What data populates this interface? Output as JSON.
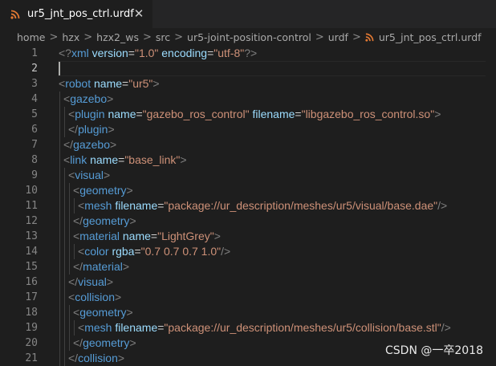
{
  "tab": {
    "label": "ur5_jnt_pos_ctrl.urdf",
    "close": "✕",
    "icon": "rss-icon"
  },
  "breadcrumb": {
    "parts": [
      "home",
      "hzx",
      "hzx2_ws",
      "src",
      "ur5-joint-position-control",
      "urdf"
    ],
    "separator": ">",
    "file": "ur5_jnt_pos_ctrl.urdf"
  },
  "editor": {
    "active_line": 2,
    "lines": [
      {
        "n": "1",
        "indent": 0,
        "tokens": [
          [
            "punct",
            "<?"
          ],
          [
            "tag",
            "xml"
          ],
          [
            "text",
            " "
          ],
          [
            "attr",
            "version"
          ],
          [
            "text",
            "="
          ],
          [
            "str",
            "\"1.0\""
          ],
          [
            "text",
            " "
          ],
          [
            "attr",
            "encoding"
          ],
          [
            "text",
            "="
          ],
          [
            "str",
            "\"utf-8\""
          ],
          [
            "punct",
            "?>"
          ]
        ]
      },
      {
        "n": "2",
        "indent": 0,
        "tokens": []
      },
      {
        "n": "3",
        "indent": 0,
        "tokens": [
          [
            "punct",
            "<"
          ],
          [
            "tag",
            "robot"
          ],
          [
            "text",
            " "
          ],
          [
            "attr",
            "name"
          ],
          [
            "text",
            "="
          ],
          [
            "str",
            "\"ur5\""
          ],
          [
            "punct",
            ">"
          ]
        ]
      },
      {
        "n": "4",
        "indent": 1,
        "tokens": [
          [
            "punct",
            "<"
          ],
          [
            "tag",
            "gazebo"
          ],
          [
            "punct",
            ">"
          ]
        ]
      },
      {
        "n": "5",
        "indent": 2,
        "tokens": [
          [
            "punct",
            "<"
          ],
          [
            "tag",
            "plugin"
          ],
          [
            "text",
            " "
          ],
          [
            "attr",
            "name"
          ],
          [
            "text",
            "="
          ],
          [
            "str",
            "\"gazebo_ros_control\""
          ],
          [
            "text",
            " "
          ],
          [
            "attr",
            "filename"
          ],
          [
            "text",
            "="
          ],
          [
            "str",
            "\"libgazebo_ros_control.so\""
          ],
          [
            "punct",
            ">"
          ]
        ]
      },
      {
        "n": "6",
        "indent": 2,
        "tokens": [
          [
            "punct",
            "</"
          ],
          [
            "tag",
            "plugin"
          ],
          [
            "punct",
            ">"
          ]
        ]
      },
      {
        "n": "7",
        "indent": 1,
        "tokens": [
          [
            "punct",
            "</"
          ],
          [
            "tag",
            "gazebo"
          ],
          [
            "punct",
            ">"
          ]
        ]
      },
      {
        "n": "8",
        "indent": 1,
        "tokens": [
          [
            "punct",
            "<"
          ],
          [
            "tag",
            "link"
          ],
          [
            "text",
            " "
          ],
          [
            "attr",
            "name"
          ],
          [
            "text",
            "="
          ],
          [
            "str",
            "\"base_link\""
          ],
          [
            "punct",
            ">"
          ]
        ]
      },
      {
        "n": "9",
        "indent": 2,
        "tokens": [
          [
            "punct",
            "<"
          ],
          [
            "tag",
            "visual"
          ],
          [
            "punct",
            ">"
          ]
        ]
      },
      {
        "n": "10",
        "indent": 3,
        "tokens": [
          [
            "punct",
            "<"
          ],
          [
            "tag",
            "geometry"
          ],
          [
            "punct",
            ">"
          ]
        ]
      },
      {
        "n": "11",
        "indent": 4,
        "tokens": [
          [
            "punct",
            "<"
          ],
          [
            "tag",
            "mesh"
          ],
          [
            "text",
            " "
          ],
          [
            "attr",
            "filename"
          ],
          [
            "text",
            "="
          ],
          [
            "str",
            "\"package://ur_description/meshes/ur5/visual/base.dae\""
          ],
          [
            "punct",
            "/>"
          ]
        ]
      },
      {
        "n": "12",
        "indent": 3,
        "tokens": [
          [
            "punct",
            "</"
          ],
          [
            "tag",
            "geometry"
          ],
          [
            "punct",
            ">"
          ]
        ]
      },
      {
        "n": "13",
        "indent": 3,
        "tokens": [
          [
            "punct",
            "<"
          ],
          [
            "tag",
            "material"
          ],
          [
            "text",
            " "
          ],
          [
            "attr",
            "name"
          ],
          [
            "text",
            "="
          ],
          [
            "str",
            "\"LightGrey\""
          ],
          [
            "punct",
            ">"
          ]
        ]
      },
      {
        "n": "14",
        "indent": 4,
        "tokens": [
          [
            "punct",
            "<"
          ],
          [
            "tag",
            "color"
          ],
          [
            "text",
            " "
          ],
          [
            "attr",
            "rgba"
          ],
          [
            "text",
            "="
          ],
          [
            "str",
            "\"0.7 0.7 0.7 1.0\""
          ],
          [
            "punct",
            "/>"
          ]
        ]
      },
      {
        "n": "15",
        "indent": 3,
        "tokens": [
          [
            "punct",
            "</"
          ],
          [
            "tag",
            "material"
          ],
          [
            "punct",
            ">"
          ]
        ]
      },
      {
        "n": "16",
        "indent": 2,
        "tokens": [
          [
            "punct",
            "</"
          ],
          [
            "tag",
            "visual"
          ],
          [
            "punct",
            ">"
          ]
        ]
      },
      {
        "n": "17",
        "indent": 2,
        "tokens": [
          [
            "punct",
            "<"
          ],
          [
            "tag",
            "collision"
          ],
          [
            "punct",
            ">"
          ]
        ]
      },
      {
        "n": "18",
        "indent": 3,
        "tokens": [
          [
            "punct",
            "<"
          ],
          [
            "tag",
            "geometry"
          ],
          [
            "punct",
            ">"
          ]
        ]
      },
      {
        "n": "19",
        "indent": 4,
        "tokens": [
          [
            "punct",
            "<"
          ],
          [
            "tag",
            "mesh"
          ],
          [
            "text",
            " "
          ],
          [
            "attr",
            "filename"
          ],
          [
            "text",
            "="
          ],
          [
            "str",
            "\"package://ur_description/meshes/ur5/collision/base.stl\""
          ],
          [
            "punct",
            "/>"
          ]
        ]
      },
      {
        "n": "20",
        "indent": 3,
        "tokens": [
          [
            "punct",
            "</"
          ],
          [
            "tag",
            "geometry"
          ],
          [
            "punct",
            ">"
          ]
        ]
      },
      {
        "n": "21",
        "indent": 2,
        "tokens": [
          [
            "punct",
            "</"
          ],
          [
            "tag",
            "collision"
          ],
          [
            "punct",
            ">"
          ]
        ]
      }
    ]
  },
  "watermark": "CSDN @一卒2018",
  "colors": {
    "tag": "#569cd6",
    "attr": "#9cdcfe",
    "str": "#ce9178",
    "punct": "#808080",
    "icon": "#e37933"
  }
}
